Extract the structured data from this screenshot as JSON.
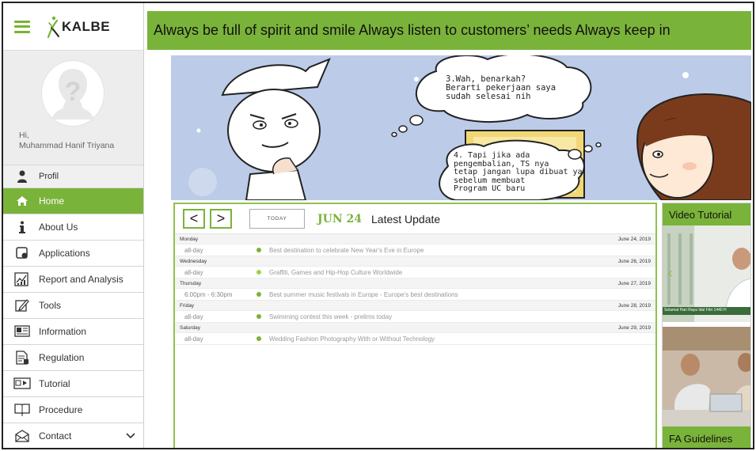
{
  "brand": {
    "name": "KALBE",
    "accent": "#7ab33a"
  },
  "profile": {
    "greeting": "Hi,",
    "user_name": "Muhammad Hanif Triyana"
  },
  "menu": [
    {
      "label": "Profil",
      "icon": "person-icon"
    },
    {
      "label": "Home",
      "icon": "home-icon",
      "active": true
    },
    {
      "label": "About Us",
      "icon": "info-icon"
    },
    {
      "label": "Applications",
      "icon": "applications-icon"
    },
    {
      "label": "Report and Analysis",
      "icon": "report-icon"
    },
    {
      "label": "Tools",
      "icon": "tools-icon"
    },
    {
      "label": "Information",
      "icon": "information-icon"
    },
    {
      "label": "Regulation",
      "icon": "regulation-icon"
    },
    {
      "label": "Tutorial",
      "icon": "tutorial-icon"
    },
    {
      "label": "Procedure",
      "icon": "procedure-icon"
    },
    {
      "label": "Contact",
      "icon": "contact-icon"
    }
  ],
  "marquee": {
    "text": "Always be full of spirit and smile   Always listen to customers’ needs   Always keep in"
  },
  "banner": {
    "bubble_top": [
      "3.Wah, benarkah?",
      "Berarti pekerjaan saya",
      "sudah selesai nih"
    ],
    "bubble_bottom": [
      "4. Tapi jika ada",
      "pengembalian, TS nya",
      "tetap jangan lupa dibuat ya",
      "sebelum membuat",
      "Program UC baru"
    ]
  },
  "calendar": {
    "prev_label": "<",
    "next_label": ">",
    "today_label": "TODAY",
    "date": "JUN 24",
    "title": "Latest Update",
    "days": [
      {
        "day": "Monday",
        "date": "June 24, 2019",
        "time": "all-day",
        "event": "Best destination to celebrate New Year's Eve in Europe"
      },
      {
        "day": "Wednesday",
        "date": "June 26, 2019",
        "time": "all-day",
        "event": "Graffiti, Games and Hip-Hop Culture Worldwide"
      },
      {
        "day": "Thursday",
        "date": "June 27, 2019",
        "time": "6:00pm - 6:30pm",
        "event": "Best summer music festivals in Europe - Europe's best destinations"
      },
      {
        "day": "Friday",
        "date": "June 28, 2019",
        "time": "all-day",
        "event": "Swimming contest this week - prelims today"
      },
      {
        "day": "Saturday",
        "date": "June 29, 2019",
        "time": "all-day",
        "event": "Wedding Fashion Photography With or Without Technology"
      }
    ]
  },
  "video_tutorial": {
    "label": "Video Tutorial",
    "caption": "Selamat Hari Raya Idul Fitri 1440 H"
  },
  "fa_guidelines": {
    "label": "FA Guidelines"
  }
}
